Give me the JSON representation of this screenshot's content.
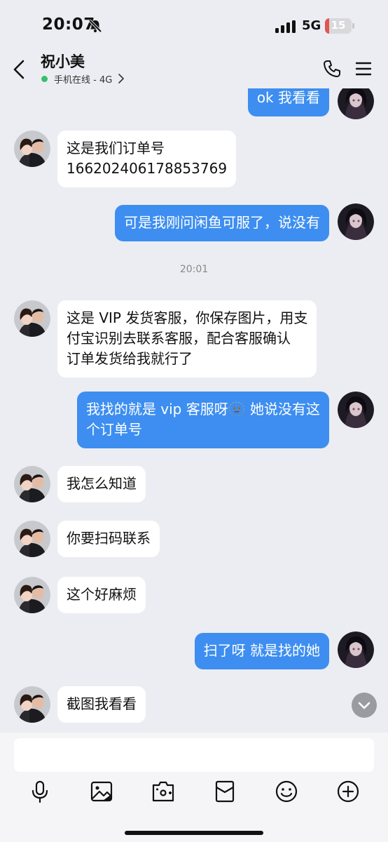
{
  "status_bar": {
    "time": "20:07",
    "network": "5G",
    "battery": "15",
    "battery_level": 0.15
  },
  "header": {
    "contact_name": "祝小美",
    "online_status": "手机在线 - 4G"
  },
  "messages": [
    {
      "side": "right",
      "text": "ok 我看看"
    },
    {
      "side": "left",
      "text": "这是我们订单号\n166202406178853769"
    },
    {
      "side": "right",
      "text": "可是我刚问闲鱼可服了，说没有"
    },
    {
      "type": "time",
      "text": "20:01"
    },
    {
      "side": "left",
      "text": "这是 VIP 发货客服，你保存图片，用支\n付宝识别去联系客服，配合客服确认\n订单发货给我就行了"
    },
    {
      "side": "right",
      "text": "我找的就是 vip 客服呀🫥 她说没有这\n个订单号"
    },
    {
      "side": "left",
      "text": "我怎么知道"
    },
    {
      "side": "left",
      "text": "你要扫码联系"
    },
    {
      "side": "left",
      "text": "这个好麻烦"
    },
    {
      "side": "right",
      "text": "扫了呀 就是找的她"
    },
    {
      "side": "left",
      "text": "截图我看看"
    }
  ],
  "input": {
    "placeholder": ""
  },
  "toolbar": [
    "microphone-icon",
    "photo-icon",
    "camera-icon",
    "red-packet-icon",
    "emoji-icon",
    "plus-icon"
  ],
  "colors": {
    "outgoing_bubble": "#3d8ef0",
    "incoming_bubble": "#ffffff",
    "background": "#ecedf2",
    "online": "#35c16a"
  }
}
